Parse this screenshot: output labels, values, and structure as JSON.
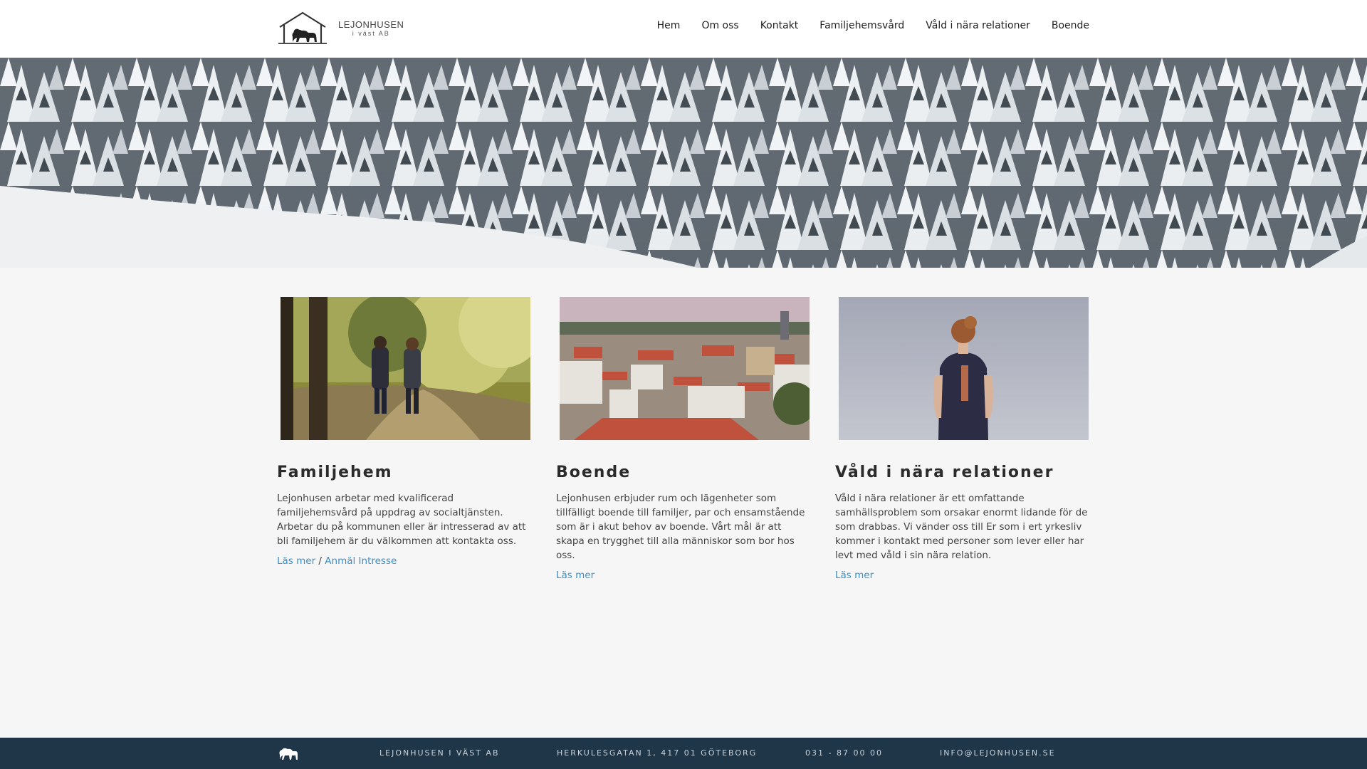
{
  "header": {
    "logo": {
      "name": "LEJONHUSEN",
      "sub": "i väst AB"
    },
    "nav": [
      "Hem",
      "Om oss",
      "Kontakt",
      "Familjehemsvård",
      "Våld i nära relationer",
      "Boende"
    ]
  },
  "cards": [
    {
      "title": "Familjehem",
      "text": "Lejonhusen arbetar med kvalificerad familjehemsvård på uppdrag av socialtjänsten. Arbetar du på kommunen eller är intresserad av att bli familjehem är du välkommen att kontakta oss.",
      "link1": "Läs mer",
      "separator": " / ",
      "link2": "Anmäl Intresse"
    },
    {
      "title": "Boende",
      "text": "Lejonhusen erbjuder rum och lägenheter som tillfälligt boende till familjer, par och ensamstående som är i akut behov av boende. Vårt mål är att skapa en trygghet till alla människor som bor hos oss.",
      "link1": "Läs mer"
    },
    {
      "title": "Våld i nära relationer",
      "text": "Våld i nära relationer är ett omfattande samhällsproblem som orsakar enormt lidande för de som drabbas. Vi vänder oss till Er som i ert yrkesliv kommer i kontakt med personer som lever eller har levt med våld i sin nära relation.",
      "link1": "Läs mer"
    }
  ],
  "footer": {
    "company": "LEJONHUSEN I VÄST AB",
    "address": "HERKULESGATAN 1, 417 01 GÖTEBORG",
    "phone": "031 - 87 00 00",
    "email": "INFO@LEJONHUSEN.SE"
  },
  "icons": {
    "logo": "lion-house-icon",
    "footer_logo": "lion-icon"
  },
  "colors": {
    "footer_bg": "#1e3648",
    "link": "#3a8fc7",
    "page_bg": "#f6f6f6"
  }
}
